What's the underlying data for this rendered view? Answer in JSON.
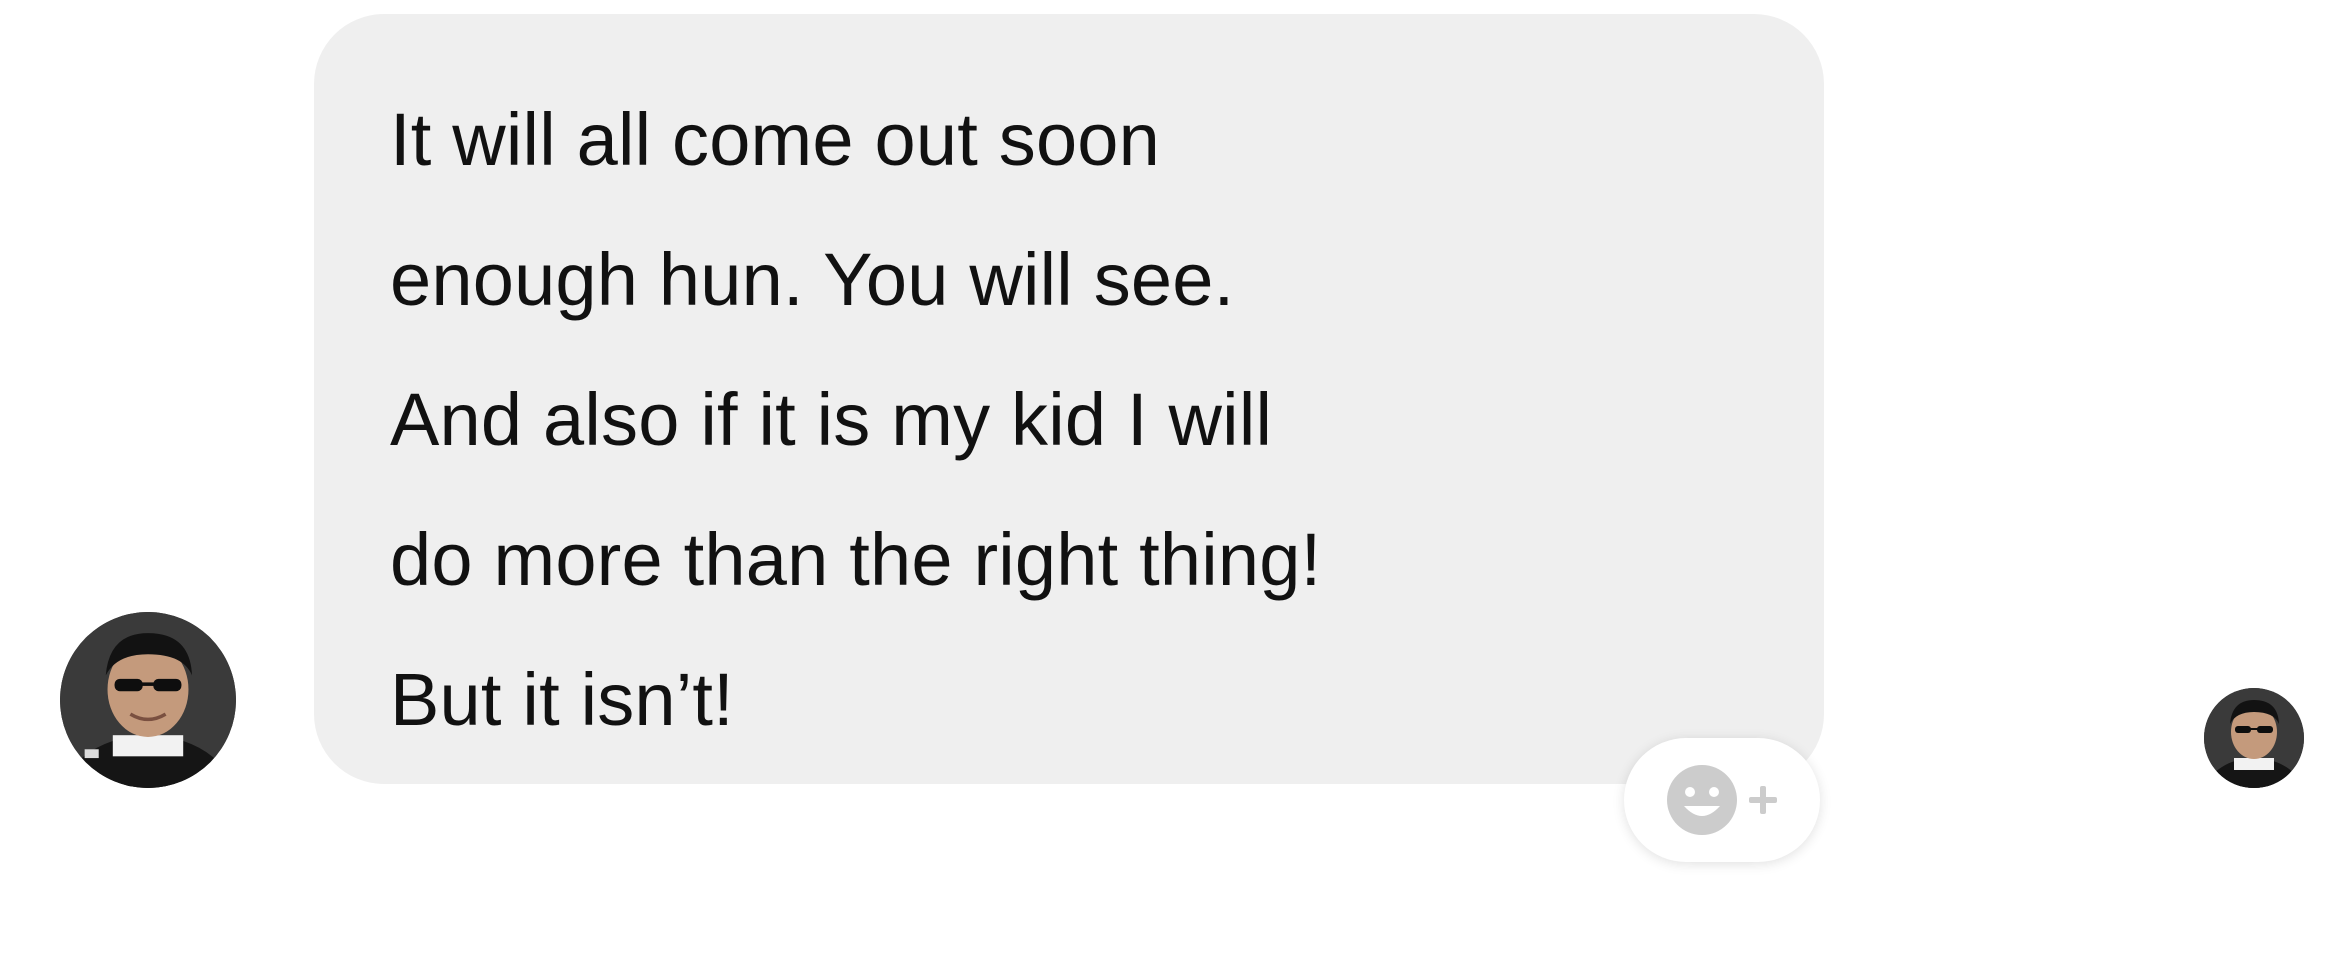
{
  "message": {
    "lines": [
      "It will all come out soon",
      "enough hun. You will see.",
      "And also if it is my kid I will",
      "do more than the right thing!",
      "But it isn’t!"
    ]
  },
  "avatars": {
    "sender_icon": "profile-photo",
    "reader_icon": "profile-photo"
  },
  "reaction": {
    "icon": "smiley-plus-icon",
    "color": "#cccccc"
  },
  "colors": {
    "bubble": "#efefef",
    "text": "#111111",
    "background": "#ffffff"
  }
}
